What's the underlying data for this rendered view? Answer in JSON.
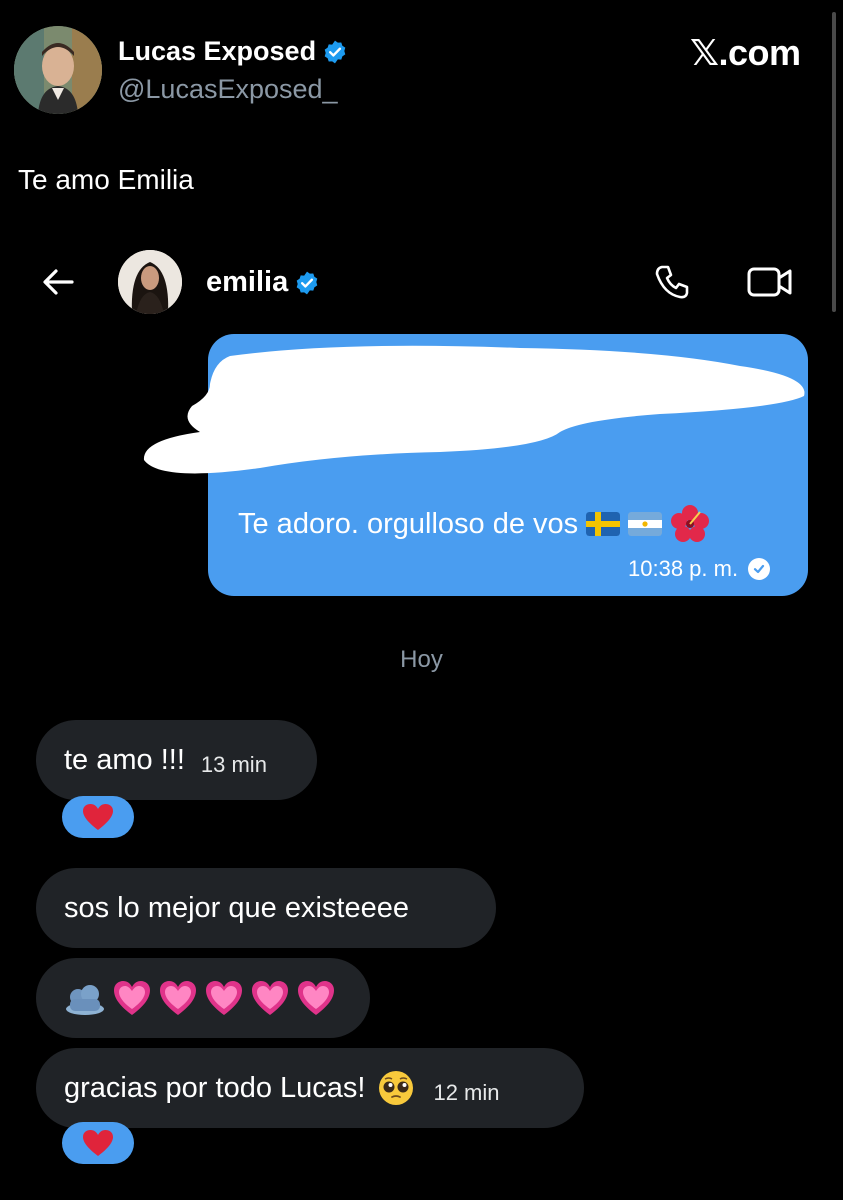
{
  "tweet": {
    "author_name": "Lucas Exposed",
    "author_handle": "@LucasExposed_",
    "site": "𝕏.com",
    "text": "Te amo Emilia"
  },
  "dm": {
    "contact_name": "emilia",
    "sent_message": {
      "text": "Te adoro. orgulloso de vos",
      "time": "10:38 p. m."
    },
    "day_separator": "Hoy",
    "received": [
      {
        "text": "te amo !!!",
        "time": "13 min",
        "reaction": "heart"
      },
      {
        "text": "sos lo mejor que existeeee",
        "time": ""
      },
      {
        "text": "",
        "time": "",
        "emojis": [
          "pink-heart",
          "pink-heart",
          "pink-heart",
          "pink-heart",
          "pink-heart"
        ]
      },
      {
        "text": "gracias por todo Lucas!",
        "time": "12 min",
        "reaction": "heart"
      }
    ]
  },
  "colors": {
    "accent": "#4a9df0",
    "bubble_received": "#202327",
    "background": "#000000",
    "muted": "#8b98a5",
    "verified": "#1d9bf0"
  },
  "icons": [
    "back-arrow-icon",
    "phone-icon",
    "video-camera-icon",
    "verified-badge-icon",
    "read-check-icon",
    "red-heart-icon",
    "pink-heart-icon",
    "pleading-face-icon",
    "sweden-flag-icon",
    "argentina-flag-icon",
    "hibiscus-icon",
    "cloud-sticker-icon"
  ]
}
